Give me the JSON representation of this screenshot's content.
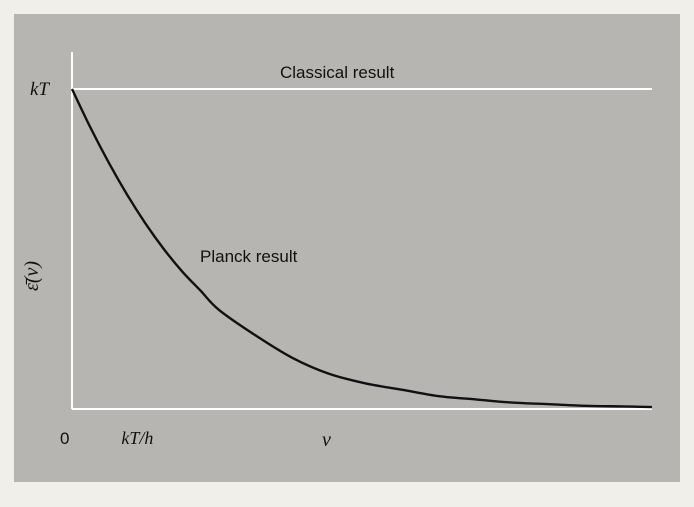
{
  "chart_data": {
    "type": "line",
    "title": "",
    "xlabel": "ν",
    "ylabel": "ε̄(ν)",
    "ytick_label": "kT",
    "xtick_labels": [
      "0",
      "kT/h"
    ],
    "x_units": "kT/h",
    "y_units": "kT",
    "xlim": [
      0,
      7.9
    ],
    "ylim": [
      0,
      1
    ],
    "grid": false,
    "series": [
      {
        "name": "Classical result",
        "x": [
          0,
          7.9
        ],
        "y": [
          1,
          1
        ]
      },
      {
        "name": "Planck result",
        "x": [
          0,
          0.25,
          0.5,
          0.75,
          1.0,
          1.25,
          1.5,
          1.75,
          2.0,
          2.5,
          3.0,
          3.5,
          4.0,
          4.5,
          5.0,
          5.5,
          6.0,
          6.5,
          7.0,
          7.5,
          7.9
        ],
        "y": [
          1.0,
          0.88,
          0.77,
          0.67,
          0.58,
          0.5,
          0.43,
          0.37,
          0.31,
          0.23,
          0.16,
          0.11,
          0.08,
          0.06,
          0.04,
          0.03,
          0.02,
          0.015,
          0.01,
          0.008,
          0.006
        ]
      }
    ]
  },
  "colors": {
    "background": "#b6b5b2",
    "classical_line": "#ffffff",
    "planck_line": "#111111",
    "axes": "#ffffff"
  }
}
